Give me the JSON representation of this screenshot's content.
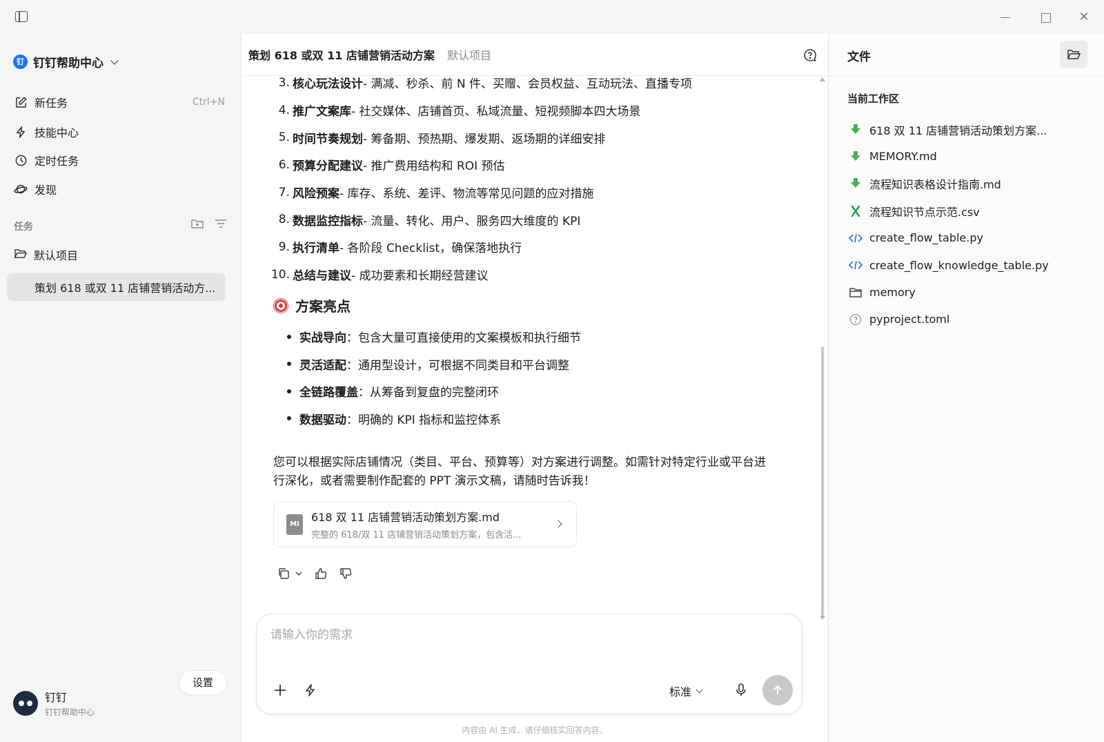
{
  "window": {
    "title_controls": [
      "minimize",
      "maximize",
      "close"
    ]
  },
  "sidebar": {
    "brand": "钉钉帮助中心",
    "nav": [
      {
        "label": "新任务",
        "shortcut": "Ctrl+N",
        "icon": "edit-icon"
      },
      {
        "label": "技能中心",
        "icon": "lightning-icon"
      },
      {
        "label": "定时任务",
        "icon": "clock-icon"
      },
      {
        "label": "发现",
        "icon": "planet-icon"
      }
    ],
    "section_label": "任务",
    "project": "默认项目",
    "active_task": "策划 618 或双 11 店铺营销活动方...",
    "user": {
      "name": "钉钉",
      "org": "钉钉帮助中心"
    },
    "settings_label": "设置"
  },
  "main": {
    "title": "策划 618 或双 11 店铺营销活动方案",
    "project": "默认项目",
    "ordered_list": [
      {
        "n": "3.",
        "bold": "核心玩法设计",
        "rest": " - 满减、秒杀、前 N 件、买赠、会员权益、互动玩法、直播专项"
      },
      {
        "n": "4.",
        "bold": "推广文案库",
        "rest": " - 社交媒体、店铺首页、私域流量、短视频脚本四大场景"
      },
      {
        "n": "5.",
        "bold": "时间节奏规划",
        "rest": " - 筹备期、预热期、爆发期、返场期的详细安排"
      },
      {
        "n": "6.",
        "bold": "预算分配建议",
        "rest": " - 推广费用结构和 ROI 预估"
      },
      {
        "n": "7.",
        "bold": "风险预案",
        "rest": " - 库存、系统、差评、物流等常见问题的应对措施"
      },
      {
        "n": "8.",
        "bold": "数据监控指标",
        "rest": " - 流量、转化、用户、服务四大维度的 KPI"
      },
      {
        "n": "9.",
        "bold": "执行清单",
        "rest": " - 各阶段 Checklist，确保落地执行"
      },
      {
        "n": "10.",
        "bold": "总结与建议",
        "rest": " - 成功要素和长期经营建议"
      }
    ],
    "highlights_heading": "方案亮点",
    "highlights": [
      {
        "bold": "实战导向",
        "rest": "：包含大量可直接使用的文案模板和执行细节"
      },
      {
        "bold": "灵活适配",
        "rest": "：通用型设计，可根据不同类目和平台调整"
      },
      {
        "bold": "全链路覆盖",
        "rest": "：从筹备到复盘的完整闭环"
      },
      {
        "bold": "数据驱动",
        "rest": "：明确的 KPI 指标和监控体系"
      }
    ],
    "closing": "您可以根据实际店铺情况（类目、平台、预算等）对方案进行调整。如需针对特定行业或平台进行深化，或者需要制作配套的 PPT 演示文稿，请随时告诉我！",
    "file_card": {
      "icon_text": "MI",
      "name": "618 双 11 店铺营销活动策划方案.md",
      "desc": "完整的 618/双 11 店铺营销活动策划方案，包含活..."
    },
    "input_placeholder": "请输入你的需求",
    "mode_label": "标准",
    "disclaimer": "内容由 AI 生成，请仔细核实回答内容。"
  },
  "files_panel": {
    "title": "文件",
    "workspace_label": "当前工作区",
    "files": [
      {
        "name": "618 双 11 店铺营销活动策划方案...",
        "type": "md",
        "icon": "markdown-download-icon"
      },
      {
        "name": "MEMORY.md",
        "type": "md",
        "icon": "markdown-download-icon"
      },
      {
        "name": "流程知识表格设计指南.md",
        "type": "md",
        "icon": "markdown-download-icon"
      },
      {
        "name": "流程知识节点示范.csv",
        "type": "csv",
        "icon": "excel-icon"
      },
      {
        "name": "create_flow_table.py",
        "type": "py",
        "icon": "code-icon"
      },
      {
        "name": "create_flow_knowledge_table.py",
        "type": "py",
        "icon": "code-icon"
      },
      {
        "name": "memory",
        "type": "folder",
        "icon": "folder-icon"
      },
      {
        "name": "pyproject.toml",
        "type": "toml",
        "icon": "unknown-file-icon"
      }
    ]
  },
  "colors": {
    "brand_blue": "#1a73ff",
    "md_green": "#4caf50",
    "csv_green": "#1e9e4a",
    "code_blue": "#2a6dd8"
  }
}
